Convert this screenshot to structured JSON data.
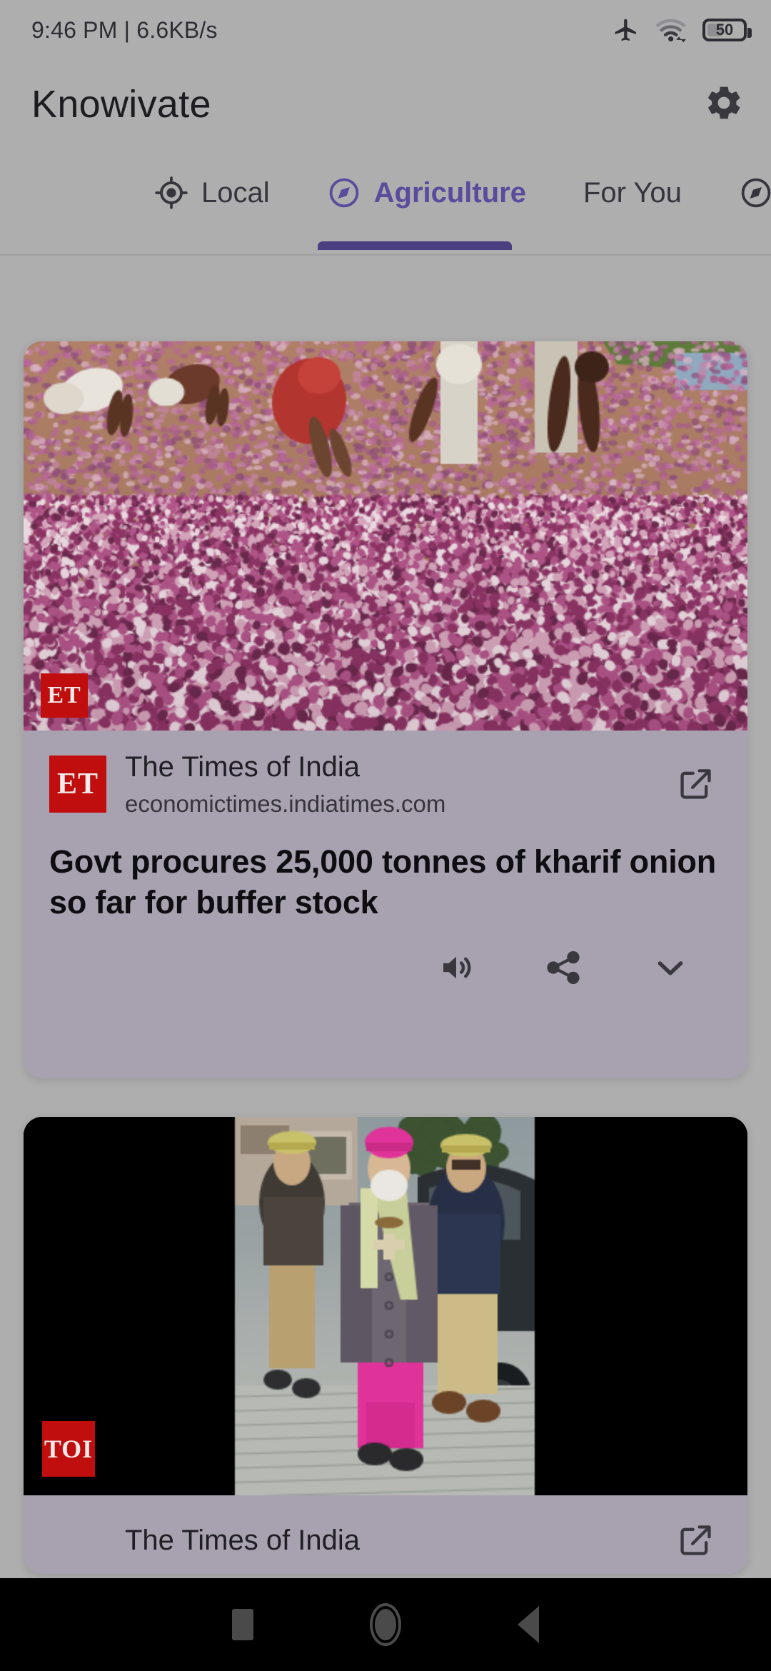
{
  "status_bar": {
    "time_and_speed": "9:46 PM | 6.6KB/s",
    "battery_level": "50",
    "icons": [
      "airplane-mode-icon",
      "wifi-icon",
      "battery-icon"
    ]
  },
  "app_bar": {
    "title": "Knowivate",
    "settings_icon": "gear-icon"
  },
  "tabs": {
    "items": [
      {
        "label": "Local",
        "icon": "gps-target-icon",
        "active": false
      },
      {
        "label": "Agriculture",
        "icon": "compass-icon",
        "active": true
      },
      {
        "label": "For You",
        "icon": "",
        "active": false
      },
      {
        "label": "",
        "icon": "compass-icon",
        "active": false
      }
    ],
    "active_color": "#5a4b9c",
    "indicator_color": "#4b3f82"
  },
  "feed": {
    "cards": [
      {
        "image_badge": "ET",
        "source_logo": "ET",
        "source_name": "The Times of India",
        "source_url": "economictimes.indiatimes.com",
        "headline": "Govt procures 25,000 tonnes of kharif onion so far for buffer stock",
        "open_icon": "external-link-icon",
        "actions": [
          {
            "icon": "speaker-icon",
            "name": "read-aloud"
          },
          {
            "icon": "share-icon",
            "name": "share"
          },
          {
            "icon": "chevron-down-icon",
            "name": "expand"
          }
        ]
      },
      {
        "image_badge": "TOI",
        "source_name": "The Times of India",
        "open_icon": "external-link-icon"
      }
    ]
  },
  "nav_bar": {
    "buttons": [
      {
        "name": "recents-button",
        "icon": "square-icon"
      },
      {
        "name": "home-button",
        "icon": "circle-icon"
      },
      {
        "name": "back-button",
        "icon": "triangle-left-icon"
      }
    ]
  },
  "colors": {
    "page_background": "#aeaeae",
    "card_background": "#a8a2b0",
    "accent_purple": "#5a4b9c",
    "brand_red": "#c00d0d",
    "nav_background": "#000000"
  }
}
